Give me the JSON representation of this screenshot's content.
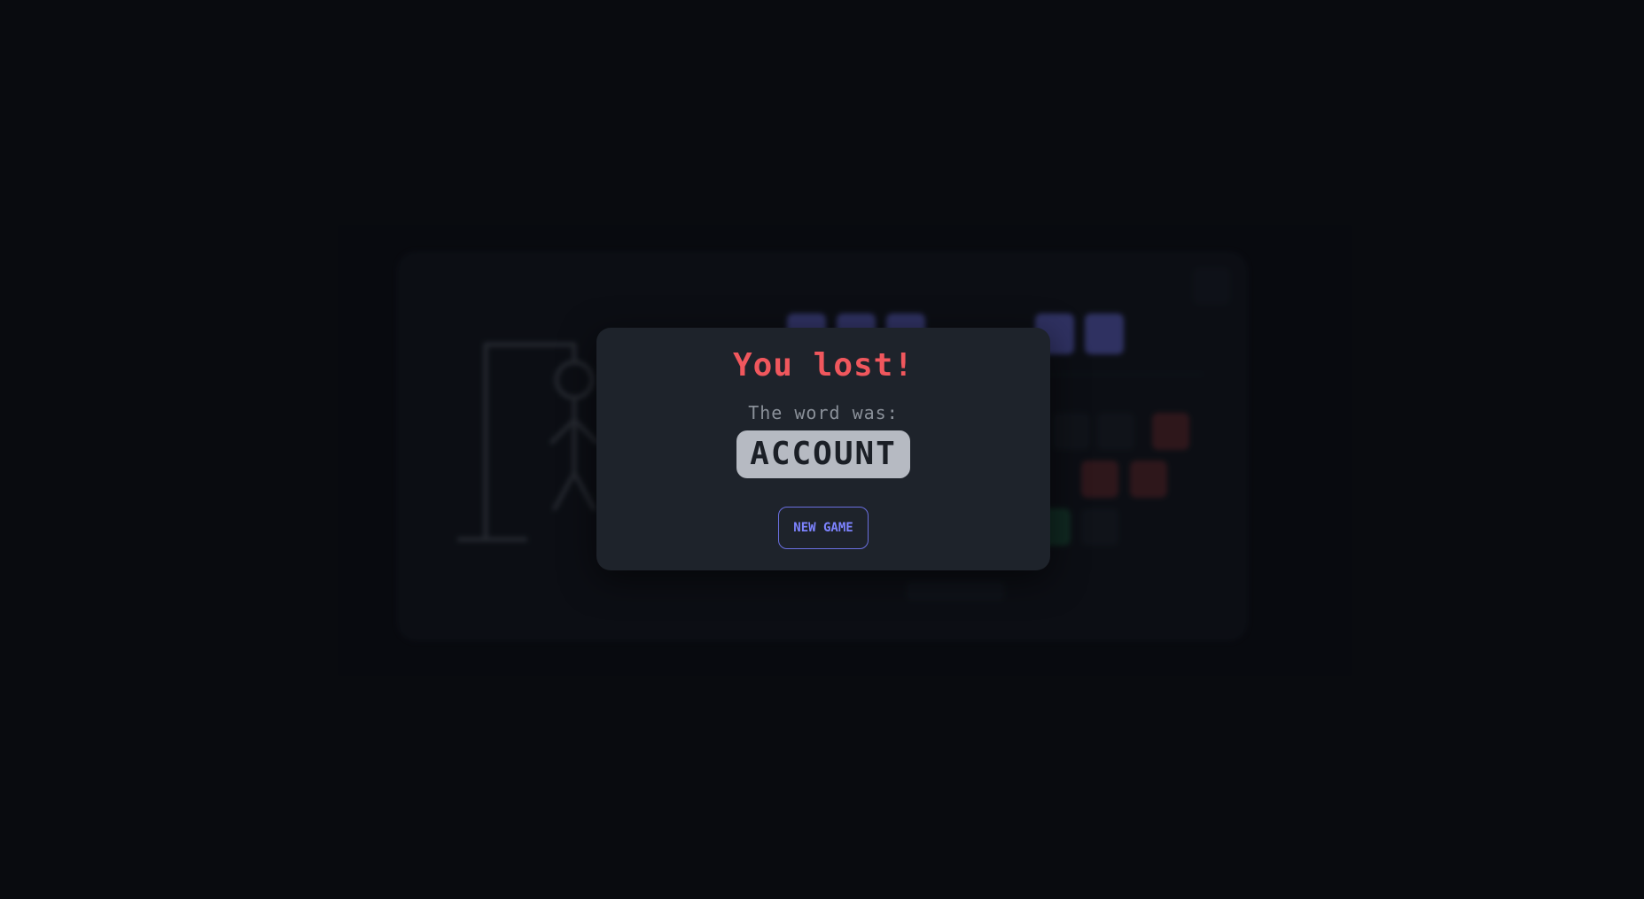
{
  "modal": {
    "title": "You lost!",
    "caption": "The word was:",
    "word": "ACCOUNT",
    "new_game_label": "NEW GAME"
  },
  "board": {
    "revealed_letters": [
      "",
      "",
      "",
      "",
      "",
      "",
      ""
    ],
    "wrong_guess_count": 6
  },
  "colors": {
    "background": "#090b10",
    "modal_bg": "#1e232b",
    "lost_red": "#f0575d",
    "accent_indigo": "#7d83ff",
    "word_chip_bg": "#b6bac2"
  }
}
